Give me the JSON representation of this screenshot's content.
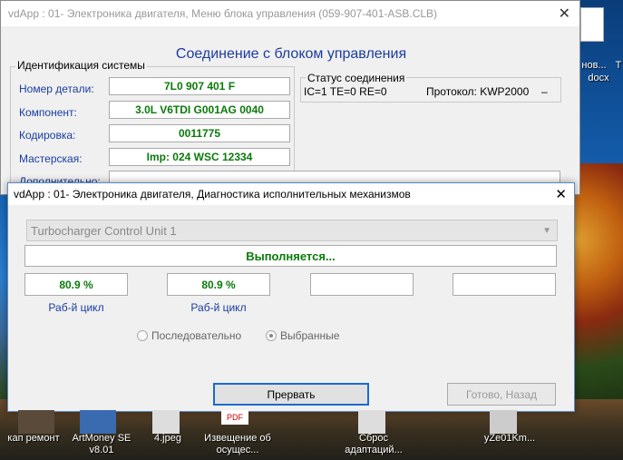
{
  "main_window": {
    "title": "vdApp : 01- Электроника двигателя,  Меню блока управления (059-907-401-ASB.CLB)",
    "close_glyph": "✕",
    "heading": "Соединение с блоком управления",
    "identification_group": "Идентификация системы",
    "fields": [
      {
        "label": "Номер детали:",
        "value": "7L0 907 401 F"
      },
      {
        "label": "Компонент:",
        "value": "3.0L V6TDI  G001AG  0040"
      },
      {
        "label": "Кодировка:",
        "value": "0011775"
      },
      {
        "label": "Мастерская:",
        "value": "Imp: 024     WSC 12334"
      },
      {
        "label": "Дополнительно:",
        "value": ""
      }
    ],
    "status_group": "Статус соединения",
    "status_line": "IC=1  TE=0   RE=0",
    "protocol": "Протокол: KWP2000",
    "protocol_suffix": "–"
  },
  "dialog": {
    "title": "vdApp : 01- Электроника двигателя,  Диагностика исполнительных механизмов",
    "close_glyph": "✕",
    "combo_value": "Turbocharger Control Unit 1",
    "progress_text": "Выполняется...",
    "values": [
      "80.9 %",
      "80.9 %",
      "",
      ""
    ],
    "value_labels": [
      "Раб-й цикл",
      "Раб-й цикл",
      "",
      ""
    ],
    "radio_sequential": "Последовательно",
    "radio_selected": "Выбранные",
    "abort_button": "Прервать",
    "done_button": "Готово, Назад"
  },
  "desktop": {
    "icons": [
      {
        "label": "кап ремонт"
      },
      {
        "label": "ArtMoney SE v8.01"
      },
      {
        "label": "4.jpeg"
      },
      {
        "label": "Извещение об осущес..."
      },
      {
        "label": "Сброс адаптаций..."
      },
      {
        "label": "yZe01Km..."
      }
    ],
    "right_labels": [
      "нов...",
      "docx",
      "T"
    ],
    "pdf_badge": "PDF"
  }
}
